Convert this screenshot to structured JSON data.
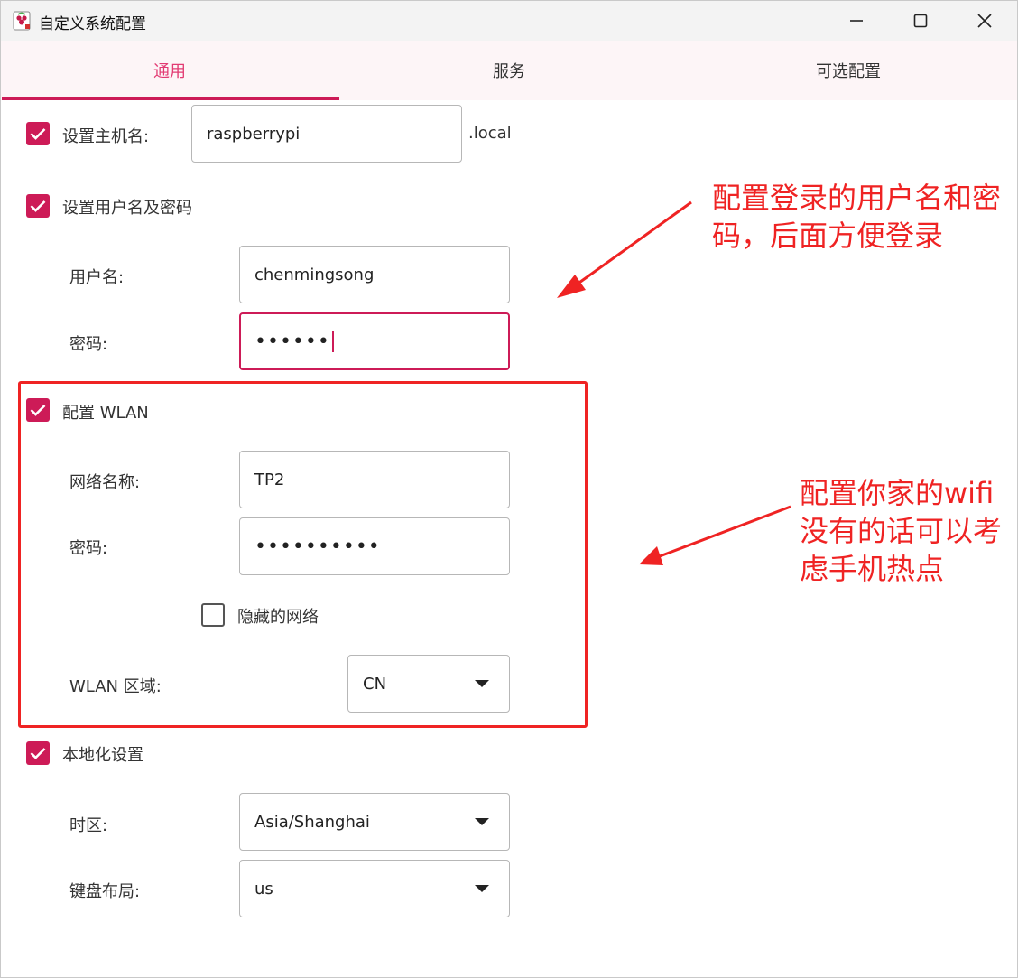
{
  "window": {
    "title": "自定义系统配置"
  },
  "tabs": [
    {
      "label": "通用",
      "active": true
    },
    {
      "label": "服务",
      "active": false
    },
    {
      "label": "可选配置",
      "active": false
    }
  ],
  "hostname": {
    "label": "设置主机名:",
    "value": "raspberrypi",
    "suffix": ".local",
    "checked": true
  },
  "user": {
    "label": "设置用户名及密码",
    "checked": true,
    "username_label": "用户名:",
    "username_value": "chenmingsong",
    "password_label": "密码:",
    "password_value": "••••••"
  },
  "wlan": {
    "label": "配置 WLAN",
    "checked": true,
    "ssid_label": "网络名称:",
    "ssid_value": "TP2",
    "password_label": "密码:",
    "password_value": "••••••••••",
    "hidden_label": "隐藏的网络",
    "hidden_checked": false,
    "country_label": "WLAN 区域:",
    "country_value": "CN"
  },
  "locale": {
    "label": "本地化设置",
    "checked": true,
    "timezone_label": "时区:",
    "timezone_value": "Asia/Shanghai",
    "keyboard_label": "键盘布局:",
    "keyboard_value": "us"
  },
  "annotations": {
    "user_note_line1": "配置登录的用户名和密",
    "user_note_line2": "码，后面方便登录",
    "wifi_note_line1": "配置你家的wifi",
    "wifi_note_line2": "没有的话可以考",
    "wifi_note_line3": "虑手机热点"
  },
  "colors": {
    "accent": "#cd1b57",
    "tab_active_text": "#e23b73",
    "annotation": "#ef2323",
    "tab_bg": "#fdf5f7"
  }
}
